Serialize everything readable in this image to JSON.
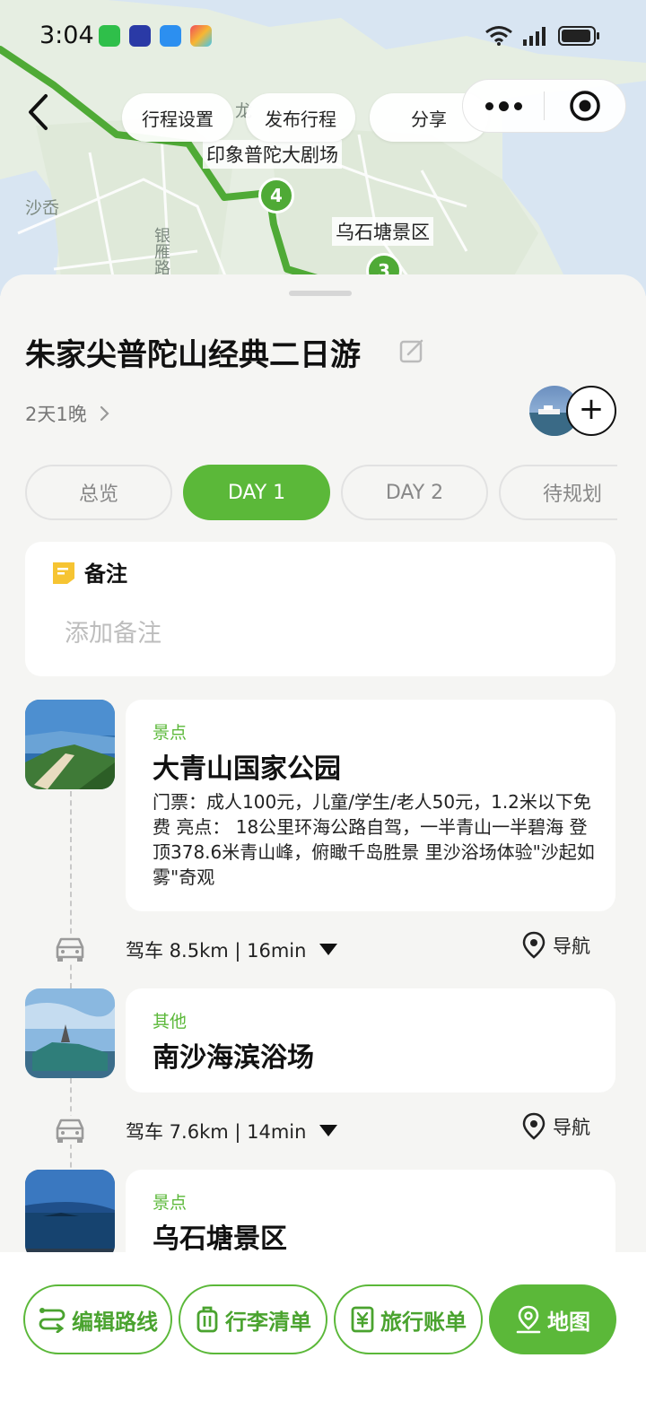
{
  "status_bar": {
    "time": "3:04"
  },
  "nav": {
    "btn_settings": "行程设置",
    "btn_publish": "发布行程",
    "btn_share": "分享"
  },
  "map": {
    "labels": {
      "theatre": "印象普陀大剧场",
      "wushitang": "乌石塘景区",
      "shacha": "沙岙",
      "road": "银雁路",
      "long": "龙"
    },
    "pins": [
      "4",
      "3"
    ]
  },
  "trip": {
    "title": "朱家尖普陀山经典二日游",
    "duration": "2天1晚"
  },
  "tabs": [
    "总览",
    "DAY 1",
    "DAY 2",
    "待规划"
  ],
  "note": {
    "title": "备注",
    "placeholder": "添加备注"
  },
  "spots": [
    {
      "category": "景点",
      "name": "大青山国家公园",
      "desc": "门票：成人100元，儿童/学生/老人50元，1.2米以下免费 亮点： 18公里环海公路自驾，一半青山一半碧海 登顶378.6米青山峰，俯瞰千岛胜景 里沙浴场体验\"沙起如雾\"奇观"
    },
    {
      "category": "其他",
      "name": "南沙海滨浴场"
    },
    {
      "category": "景点",
      "name": "乌石塘景区"
    }
  ],
  "routes": [
    {
      "text": "驾车 8.5km | 16min",
      "nav": "导航"
    },
    {
      "text": "驾车 7.6km | 14min",
      "nav": "导航"
    }
  ],
  "bottom": {
    "edit_route": "编辑路线",
    "luggage": "行李清单",
    "bill": "旅行账单",
    "map": "地图"
  },
  "colors": {
    "accent": "#5bb839",
    "route": "#4faa36"
  }
}
